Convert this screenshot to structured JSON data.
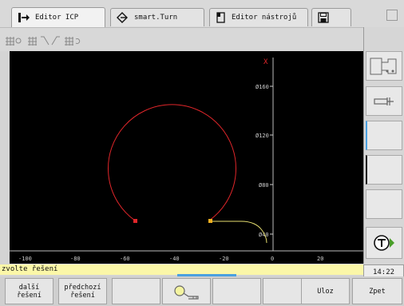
{
  "tabs": [
    {
      "label": "Editor ICP",
      "icon": "arrow-right-icon",
      "active": true
    },
    {
      "label": "smart.Turn",
      "icon": "diamond-arrow-icon",
      "active": false
    },
    {
      "label": "Editor nástrojů",
      "icon": "tool-holder-icon",
      "active": false
    },
    {
      "label": "",
      "icon": "save-disk-icon",
      "active": false
    }
  ],
  "symbol_toolbar": [
    "grid-circle-icon",
    "grid-line-icon",
    "line-diagonal-icon",
    "line-diagonal-icon",
    "grid-arc-icon"
  ],
  "canvas": {
    "axis_label_x_marker": "X",
    "y_ticks": [
      "Ø160",
      "Ø120",
      "Ø80",
      "Ø40"
    ],
    "x_ticks": [
      "-100",
      "-80",
      "-60",
      "-40",
      "-20",
      "0",
      "20"
    ],
    "colors": {
      "contour": "#e0262a",
      "solution": "#f0e080",
      "axis": "#cccccc",
      "background": "#000000"
    }
  },
  "prompt": {
    "text": "zvolte řešení"
  },
  "right_softkeys": [
    "turning-contour-icon",
    "drill-icon",
    "",
    "",
    "",
    "",
    "tool-t-icon"
  ],
  "time": "14:22",
  "bottom_softkeys": [
    {
      "label1": "další",
      "label2": "řešení"
    },
    {
      "label1": "předchozí",
      "label2": "řešení"
    },
    {
      "label1": "",
      "label2": ""
    },
    {
      "label1": "",
      "label2": "",
      "icon": "magnifier-key-icon"
    },
    {
      "label1": "",
      "label2": ""
    },
    {
      "label1": "",
      "label2": ""
    },
    {
      "label1": "Uloz",
      "label2": ""
    },
    {
      "label1": "Zpet",
      "label2": ""
    }
  ]
}
